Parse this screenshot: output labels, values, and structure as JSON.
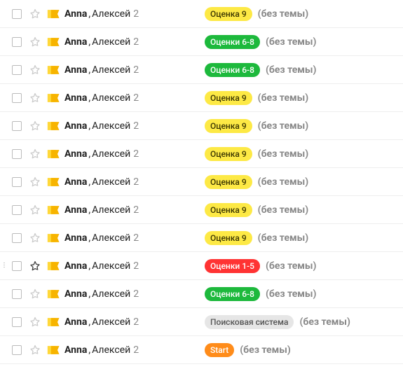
{
  "brief": "(без темы)",
  "sender1": "Anna",
  "sender2": "Алексей",
  "count": "2",
  "tag_colors": {
    "rate9": {
      "class": "tag-yellow",
      "label": "Оценка 9"
    },
    "rate68": {
      "class": "tag-green",
      "label": "Оценки 6-8"
    },
    "rate15": {
      "class": "tag-red",
      "label": "Оценки 1-5"
    },
    "search": {
      "class": "tag-gray",
      "label": "Поисковая система"
    },
    "start": {
      "class": "tag-orange",
      "label": "Start"
    }
  },
  "rows": [
    {
      "tag": "rate9",
      "hover": false
    },
    {
      "tag": "rate68",
      "hover": false
    },
    {
      "tag": "rate68",
      "hover": false
    },
    {
      "tag": "rate9",
      "hover": false
    },
    {
      "tag": "rate9",
      "hover": false
    },
    {
      "tag": "rate9",
      "hover": false
    },
    {
      "tag": "rate9",
      "hover": false
    },
    {
      "tag": "rate9",
      "hover": false
    },
    {
      "tag": "rate9",
      "hover": false
    },
    {
      "tag": "rate15",
      "hover": true
    },
    {
      "tag": "rate68",
      "hover": false
    },
    {
      "tag": "search",
      "hover": false
    },
    {
      "tag": "start",
      "hover": false
    }
  ]
}
